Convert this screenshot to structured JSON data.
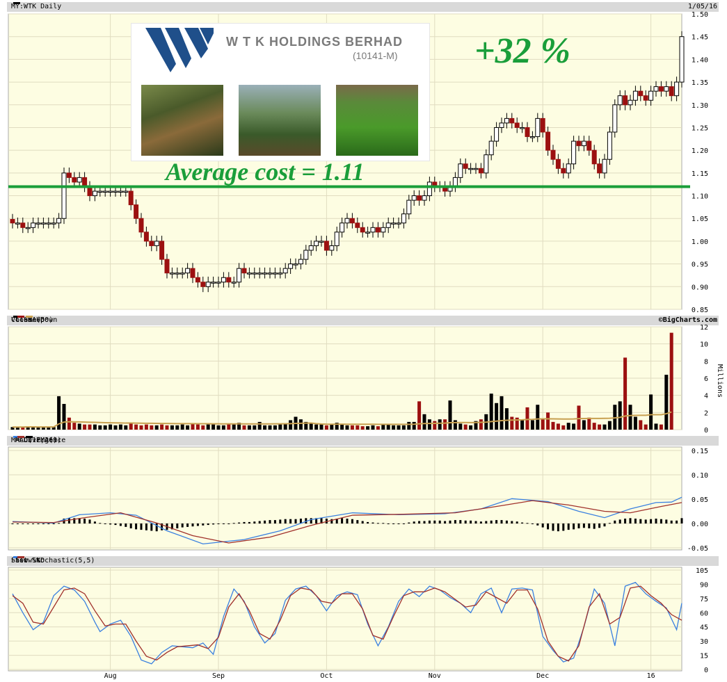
{
  "header": {
    "symbol": "MY:WTK Daily",
    "date": "1/05/16"
  },
  "volume_legend": {
    "title": "Volume+",
    "close_up": "Close Up",
    "close_down": "Close Down",
    "sma": "SMA(50)",
    "credit": "©BigCharts.com"
  },
  "macd_legend": {
    "macd": "MACD(12,26)",
    "ema": "MACD EMA(9)",
    "divergence": "Divergence"
  },
  "stoch_legend": {
    "title": "Slow Stochastic(5,5)",
    "fast": "Fast %K",
    "slow": "Slow %D"
  },
  "overlay": {
    "company_name": "W T K  HOLDINGS BERHAD",
    "company_reg": "(10141-M)",
    "gain": "+32 %",
    "average_cost": "Average cost = 1.11",
    "average_cost_value": 1.12
  },
  "colors": {
    "up": "#000000",
    "down": "#9c1010",
    "macd": "#3a80e0",
    "ema": "#a0302a",
    "sma": "#c8a050",
    "stoch_fast": "#3a80e0",
    "stoch_slow": "#a0302a",
    "grid": "#e0dcc0",
    "panel_bg": "#fdfde2",
    "overlay_green": "#1a9e3a",
    "logo_blue": "#1f4f8a"
  },
  "icons": [
    "logo-w-icon",
    "forest-photo",
    "tree-photo",
    "seedling-photo"
  ],
  "chart_data": [
    {
      "type": "candlestick",
      "title": "MY:WTK Daily",
      "ylim": [
        0.85,
        1.5
      ],
      "y_ticks": [
        "0.85",
        "0.90",
        "0.95",
        "1.00",
        "1.05",
        "1.10",
        "1.15",
        "1.20",
        "1.25",
        "1.30",
        "1.35",
        "1.40",
        "1.45",
        "1.50"
      ],
      "x_ticks": [
        "Aug",
        "Sep",
        "Oct",
        "Nov",
        "Dec",
        "16"
      ],
      "x_tick_index": [
        19,
        40,
        61,
        82,
        103,
        124
      ],
      "close": [
        1.04,
        1.04,
        1.03,
        1.03,
        1.04,
        1.04,
        1.04,
        1.04,
        1.04,
        1.05,
        1.15,
        1.14,
        1.13,
        1.14,
        1.12,
        1.1,
        1.11,
        1.11,
        1.11,
        1.11,
        1.11,
        1.11,
        1.11,
        1.08,
        1.05,
        1.02,
        1.0,
        0.99,
        1.0,
        0.96,
        0.93,
        0.93,
        0.93,
        0.93,
        0.94,
        0.92,
        0.91,
        0.9,
        0.91,
        0.91,
        0.91,
        0.92,
        0.91,
        0.91,
        0.94,
        0.93,
        0.93,
        0.93,
        0.93,
        0.93,
        0.93,
        0.93,
        0.93,
        0.94,
        0.95,
        0.95,
        0.96,
        0.98,
        0.99,
        1.0,
        1.0,
        0.98,
        0.99,
        1.02,
        1.04,
        1.05,
        1.04,
        1.03,
        1.02,
        1.02,
        1.03,
        1.02,
        1.03,
        1.04,
        1.04,
        1.04,
        1.06,
        1.09,
        1.1,
        1.09,
        1.1,
        1.13,
        1.12,
        1.12,
        1.11,
        1.12,
        1.14,
        1.17,
        1.16,
        1.16,
        1.16,
        1.15,
        1.19,
        1.22,
        1.25,
        1.26,
        1.27,
        1.26,
        1.25,
        1.25,
        1.23,
        1.23,
        1.27,
        1.24,
        1.2,
        1.18,
        1.16,
        1.15,
        1.17,
        1.22,
        1.21,
        1.22,
        1.2,
        1.17,
        1.15,
        1.18,
        1.24,
        1.3,
        1.32,
        1.3,
        1.31,
        1.33,
        1.32,
        1.31,
        1.33,
        1.34,
        1.33,
        1.34,
        1.32,
        1.35,
        1.45
      ],
      "volume_millions": [
        0.3,
        0.3,
        0.3,
        0.4,
        0.3,
        0.3,
        0.3,
        0.3,
        0.3,
        3.9,
        3.0,
        1.4,
        0.8,
        0.7,
        0.6,
        0.6,
        0.6,
        0.5,
        0.5,
        0.6,
        0.5,
        0.6,
        0.5,
        0.8,
        0.6,
        0.5,
        0.6,
        0.5,
        0.5,
        0.6,
        0.5,
        0.5,
        0.5,
        0.6,
        0.5,
        0.7,
        0.6,
        0.5,
        0.6,
        0.6,
        0.5,
        0.5,
        0.7,
        0.6,
        0.8,
        0.5,
        0.5,
        0.5,
        0.9,
        0.5,
        0.5,
        0.5,
        0.6,
        0.7,
        1.1,
        1.5,
        1.2,
        0.9,
        0.8,
        0.6,
        0.7,
        0.5,
        0.6,
        0.8,
        0.6,
        0.5,
        0.5,
        0.5,
        0.4,
        0.4,
        0.5,
        0.4,
        0.6,
        0.6,
        0.5,
        0.5,
        0.5,
        0.9,
        0.9,
        3.3,
        1.8,
        1.2,
        1.0,
        1.2,
        1.2,
        3.4,
        1.1,
        0.7,
        0.6,
        0.5,
        1.0,
        1.2,
        1.8,
        4.2,
        3.1,
        3.9,
        2.5,
        1.5,
        1.4,
        1.2,
        2.6,
        1.1,
        2.9,
        1.2,
        2.0,
        0.9,
        0.7,
        0.5,
        0.8,
        0.7,
        2.8,
        1.1,
        1.4,
        0.8,
        0.6,
        0.6,
        1.0,
        2.9,
        3.3,
        8.4,
        2.9,
        1.5,
        1.1,
        0.6,
        4.1,
        0.7,
        0.6,
        6.4,
        11.3
      ],
      "volume_ylim": [
        0,
        12
      ],
      "volume_ticks": [
        "0",
        "2",
        "4",
        "6",
        "8",
        "10",
        "12"
      ],
      "volume_unit": "Millions"
    },
    {
      "type": "line",
      "title": "MACD(12,26)",
      "ylim": [
        -0.05,
        0.15
      ],
      "y_ticks": [
        "-0.05",
        "0.00",
        "0.05",
        "0.10",
        "0.15"
      ],
      "series": [
        {
          "name": "MACD(12,26)",
          "points": [
            [
              0,
              0.004
            ],
            [
              8,
              0.001
            ],
            [
              13,
              0.018
            ],
            [
              19,
              0.022
            ],
            [
              24,
              0.017
            ],
            [
              30,
              -0.015
            ],
            [
              37,
              -0.042
            ],
            [
              45,
              -0.033
            ],
            [
              52,
              -0.015
            ],
            [
              58,
              0.008
            ],
            [
              66,
              0.022
            ],
            [
              75,
              0.018
            ],
            [
              84,
              0.02
            ],
            [
              91,
              0.03
            ],
            [
              97,
              0.051
            ],
            [
              104,
              0.045
            ],
            [
              110,
              0.025
            ],
            [
              115,
              0.012
            ],
            [
              120,
              0.03
            ],
            [
              125,
              0.043
            ],
            [
              128,
              0.044
            ],
            [
              130,
              0.054
            ]
          ]
        },
        {
          "name": "MACD EMA(9)",
          "points": [
            [
              0,
              0.003
            ],
            [
              8,
              0.002
            ],
            [
              14,
              0.012
            ],
            [
              21,
              0.022
            ],
            [
              28,
              0.001
            ],
            [
              35,
              -0.025
            ],
            [
              42,
              -0.04
            ],
            [
              50,
              -0.028
            ],
            [
              58,
              -0.004
            ],
            [
              66,
              0.017
            ],
            [
              76,
              0.019
            ],
            [
              86,
              0.022
            ],
            [
              94,
              0.035
            ],
            [
              101,
              0.047
            ],
            [
              108,
              0.038
            ],
            [
              115,
              0.025
            ],
            [
              120,
              0.022
            ],
            [
              126,
              0.035
            ],
            [
              130,
              0.043
            ]
          ]
        }
      ],
      "divergence": [
        0.0,
        0.0,
        -0.001,
        -0.001,
        -0.001,
        0.0,
        0.0,
        0.0,
        -0.001,
        0.001,
        0.01,
        0.011,
        0.011,
        0.011,
        0.01,
        0.008,
        0.004,
        0.001,
        -0.001,
        -0.002,
        -0.003,
        -0.005,
        -0.007,
        -0.01,
        -0.012,
        -0.013,
        -0.014,
        -0.015,
        -0.016,
        -0.014,
        -0.013,
        -0.012,
        -0.01,
        -0.008,
        -0.007,
        -0.006,
        -0.005,
        -0.004,
        -0.003,
        -0.002,
        -0.001,
        0.0,
        0.0,
        0.001,
        0.002,
        0.003,
        0.003,
        0.004,
        0.005,
        0.006,
        0.007,
        0.007,
        0.008,
        0.009,
        0.009,
        0.009,
        0.01,
        0.011,
        0.011,
        0.011,
        0.012,
        0.01,
        0.009,
        0.01,
        0.011,
        0.01,
        0.009,
        0.007,
        0.005,
        0.003,
        0.002,
        0.001,
        0.001,
        0.0,
        0.0,
        -0.001,
        0.0,
        0.002,
        0.004,
        0.005,
        0.005,
        0.006,
        0.006,
        0.006,
        0.005,
        0.006,
        0.007,
        0.007,
        0.006,
        0.006,
        0.005,
        0.004,
        0.005,
        0.006,
        0.007,
        0.007,
        0.006,
        0.005,
        0.004,
        0.002,
        0.001,
        -0.001,
        -0.004,
        -0.008,
        -0.012,
        -0.015,
        -0.016,
        -0.015,
        -0.013,
        -0.012,
        -0.01,
        -0.009,
        -0.01,
        -0.011,
        -0.009,
        -0.006,
        0.001,
        0.006,
        0.008,
        0.01,
        0.011,
        0.01,
        0.009,
        0.008,
        0.009,
        0.01,
        0.009,
        0.008,
        0.006,
        0.006,
        0.011
      ]
    },
    {
      "type": "line",
      "title": "Slow Stochastic(5,5)",
      "ylim": [
        0,
        105
      ],
      "y_ticks": [
        "0",
        "15",
        "30",
        "45",
        "60",
        "75",
        "90",
        "105"
      ],
      "series": [
        {
          "name": "Fast %K",
          "points": [
            [
              0,
              80
            ],
            [
              2,
              60
            ],
            [
              4,
              42
            ],
            [
              6,
              50
            ],
            [
              8,
              78
            ],
            [
              10,
              88
            ],
            [
              12,
              84
            ],
            [
              14,
              72
            ],
            [
              16,
              50
            ],
            [
              17,
              40
            ],
            [
              19,
              48
            ],
            [
              21,
              52
            ],
            [
              23,
              35
            ],
            [
              25,
              10
            ],
            [
              27,
              6
            ],
            [
              29,
              18
            ],
            [
              31,
              25
            ],
            [
              33,
              24
            ],
            [
              35,
              23
            ],
            [
              37,
              28
            ],
            [
              39,
              16
            ],
            [
              41,
              56
            ],
            [
              43,
              85
            ],
            [
              45,
              72
            ],
            [
              47,
              45
            ],
            [
              49,
              28
            ],
            [
              51,
              38
            ],
            [
              53,
              73
            ],
            [
              55,
              85
            ],
            [
              57,
              88
            ],
            [
              59,
              78
            ],
            [
              61,
              62
            ],
            [
              63,
              78
            ],
            [
              65,
              82
            ],
            [
              67,
              79
            ],
            [
              69,
              48
            ],
            [
              71,
              25
            ],
            [
              73,
              45
            ],
            [
              75,
              72
            ],
            [
              77,
              85
            ],
            [
              79,
              77
            ],
            [
              81,
              88
            ],
            [
              83,
              84
            ],
            [
              85,
              76
            ],
            [
              87,
              70
            ],
            [
              89,
              60
            ],
            [
              91,
              80
            ],
            [
              93,
              86
            ],
            [
              95,
              60
            ],
            [
              97,
              85
            ],
            [
              99,
              86
            ],
            [
              101,
              84
            ],
            [
              103,
              35
            ],
            [
              105,
              20
            ],
            [
              107,
              8
            ],
            [
              109,
              12
            ],
            [
              111,
              45
            ],
            [
              113,
              85
            ],
            [
              115,
              70
            ],
            [
              117,
              25
            ],
            [
              119,
              88
            ],
            [
              121,
              92
            ],
            [
              123,
              80
            ],
            [
              125,
              72
            ],
            [
              127,
              65
            ],
            [
              129,
              42
            ],
            [
              130,
              70
            ]
          ]
        },
        {
          "name": "Slow %D",
          "points": [
            [
              0,
              78
            ],
            [
              2,
              70
            ],
            [
              4,
              50
            ],
            [
              6,
              48
            ],
            [
              8,
              66
            ],
            [
              10,
              84
            ],
            [
              12,
              86
            ],
            [
              14,
              80
            ],
            [
              16,
              62
            ],
            [
              18,
              46
            ],
            [
              20,
              48
            ],
            [
              22,
              48
            ],
            [
              24,
              30
            ],
            [
              26,
              14
            ],
            [
              28,
              10
            ],
            [
              30,
              18
            ],
            [
              32,
              24
            ],
            [
              34,
              25
            ],
            [
              36,
              26
            ],
            [
              38,
              22
            ],
            [
              40,
              34
            ],
            [
              42,
              66
            ],
            [
              44,
              80
            ],
            [
              46,
              62
            ],
            [
              48,
              38
            ],
            [
              50,
              32
            ],
            [
              52,
              52
            ],
            [
              54,
              78
            ],
            [
              56,
              86
            ],
            [
              58,
              84
            ],
            [
              60,
              72
            ],
            [
              62,
              70
            ],
            [
              64,
              80
            ],
            [
              66,
              80
            ],
            [
              68,
              64
            ],
            [
              70,
              36
            ],
            [
              72,
              32
            ],
            [
              74,
              56
            ],
            [
              76,
              78
            ],
            [
              78,
              82
            ],
            [
              80,
              82
            ],
            [
              82,
              86
            ],
            [
              84,
              82
            ],
            [
              86,
              74
            ],
            [
              88,
              66
            ],
            [
              90,
              68
            ],
            [
              92,
              82
            ],
            [
              94,
              76
            ],
            [
              96,
              70
            ],
            [
              98,
              84
            ],
            [
              100,
              84
            ],
            [
              102,
              64
            ],
            [
              104,
              30
            ],
            [
              106,
              14
            ],
            [
              108,
              9
            ],
            [
              110,
              25
            ],
            [
              112,
              66
            ],
            [
              114,
              80
            ],
            [
              116,
              48
            ],
            [
              118,
              55
            ],
            [
              120,
              86
            ],
            [
              122,
              88
            ],
            [
              124,
              78
            ],
            [
              126,
              70
            ],
            [
              128,
              58
            ],
            [
              130,
              52
            ]
          ]
        }
      ]
    }
  ]
}
